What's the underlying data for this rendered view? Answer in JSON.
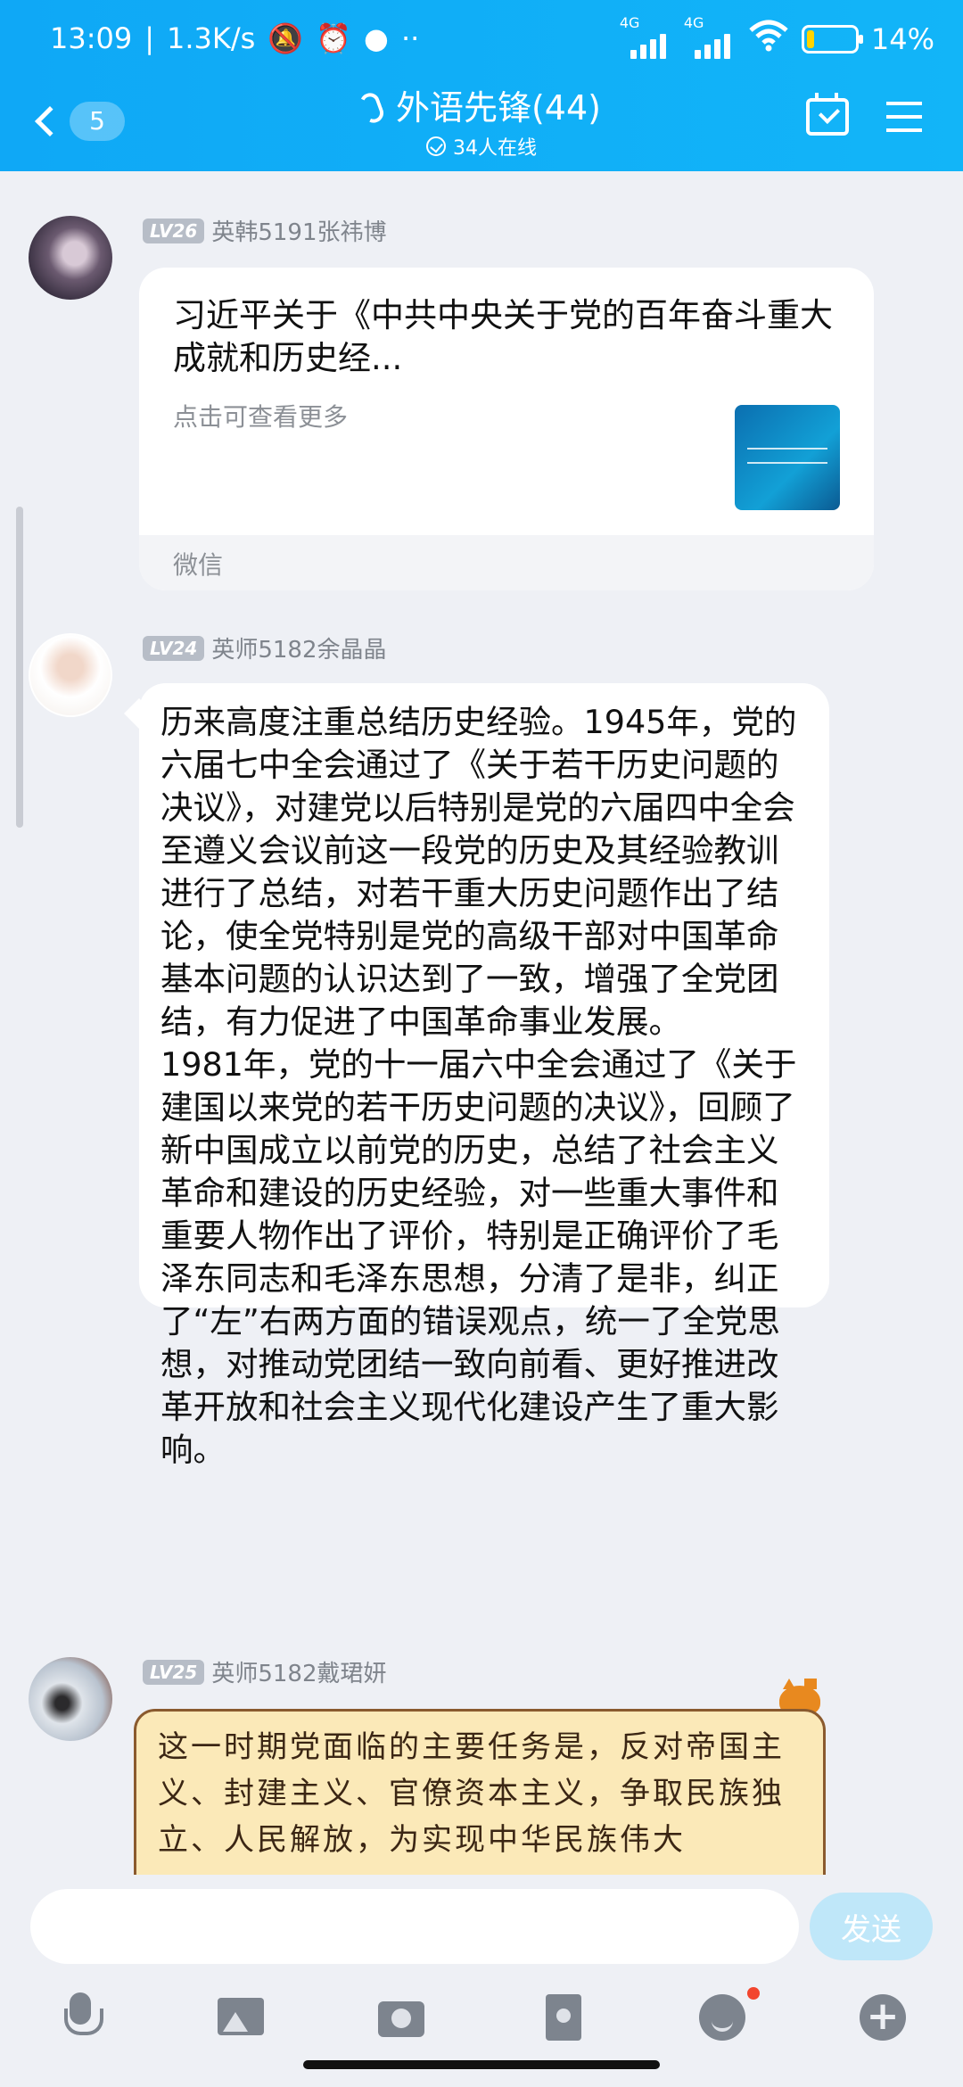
{
  "status_bar": {
    "time": "13:09",
    "speed": "1.3K/s",
    "more": "··",
    "network1": "4G",
    "network2": "4G",
    "battery": "14%",
    "battery_level": 0.14
  },
  "header": {
    "back_count": "5",
    "title": "外语先锋(44)",
    "online": "34人在线"
  },
  "messages": [
    {
      "level": "LV26",
      "sender": "英韩5191张祎博",
      "card_title": "习近平关于《中共中央关于党的百年奋斗重大成就和历史经...",
      "card_subtitle": "点击可查看更多",
      "card_source": "微信"
    },
    {
      "level": "LV24",
      "sender": "英师5182余晶晶",
      "text_p1": "历来高度注重总结历史经验。1945年，党的六届七中全会通过了《关于若干历史问题的决议》，对建党以后特别是党的六届四中全会至遵义会议前这一段党的历史及其经验教训进行了总结，对若干重大历史问题作出了结论，使全党特别是党的高级干部对中国革命基本问题的认识达到了一致，增强了全党团结，有力促进了中国革命事业发展。",
      "text_p2": "1981年，党的十一届六中全会通过了《关于建国以来党的若干历史问题的决议》，回顾了新中国成立以前党的历史，总结了社会主义革命和建设的历史经验，对一些重大事件和重要人物作出了评价，特别是正确评价了毛泽东同志和毛泽东思想，分清了是非，纠正了“左”右两方面的错误观点，统一了全党思想，对推动党团结一致向前看、更好推进改革开放和社会主义现代化建设产生了重大影响。"
    },
    {
      "level": "LV25",
      "sender": "英师5182戴珺妍",
      "text": "这一时期党面临的主要任务是，反对帝国主义、封建主义、官僚资本主义，争取民族独立、人民解放，为实现中华民族伟大"
    }
  ],
  "input": {
    "placeholder": "",
    "send_label": "发送"
  },
  "colors": {
    "header": "#12b5f8",
    "background": "#eef0f5",
    "send_button": "#bfe7f9",
    "note_bg": "#fbe9b8"
  }
}
